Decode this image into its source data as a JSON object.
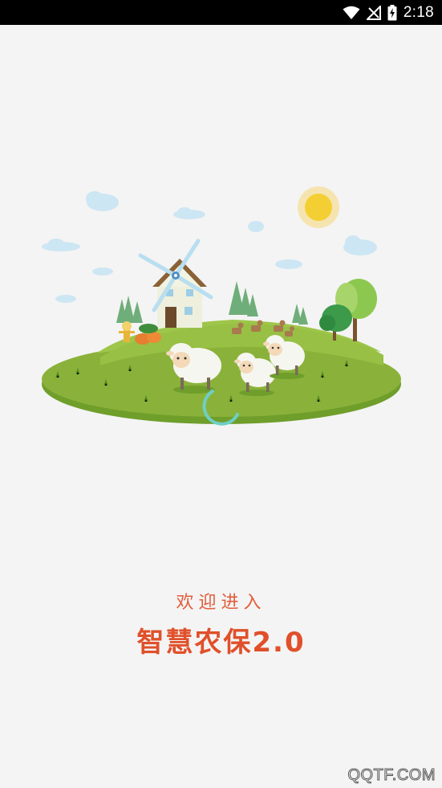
{
  "status_bar": {
    "time": "2:18",
    "icons": [
      "wifi-icon",
      "no-signal-icon",
      "battery-charging-icon"
    ]
  },
  "splash": {
    "illustration": "farm-island-illustration",
    "loading": true
  },
  "welcome": {
    "subtitle": "欢迎进入",
    "title": "智慧农保2.0"
  },
  "watermark": "QQTF.COM",
  "colors": {
    "background": "#f4f4f4",
    "accent": "#e0502a",
    "spinner": "#6fcfc4",
    "grass": "#8ab23a"
  }
}
